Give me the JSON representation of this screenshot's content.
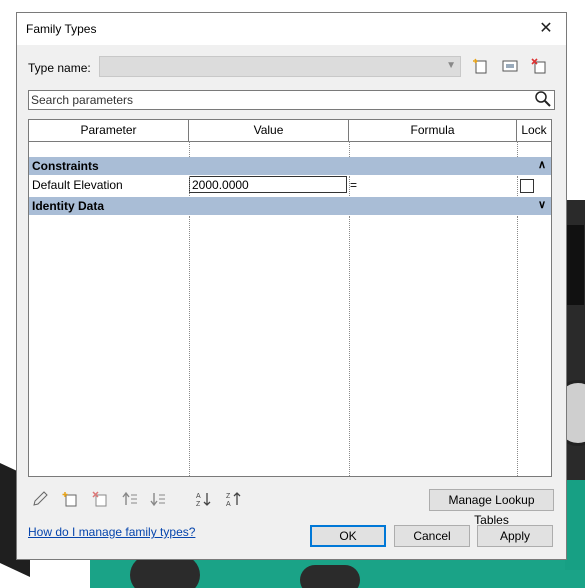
{
  "dialog": {
    "title": "Family Types",
    "close_glyph": "✕"
  },
  "type_name": {
    "label": "Type name:",
    "value": ""
  },
  "search": {
    "placeholder": "Search parameters"
  },
  "grid": {
    "headers": [
      "Parameter",
      "Value",
      "Formula",
      "Lock"
    ],
    "groups": [
      {
        "name": "Constraints",
        "state": "expanded",
        "rows": [
          {
            "parameter": "Default Elevation",
            "value": "2000.0000",
            "formula": "=",
            "locked": false
          }
        ]
      },
      {
        "name": "Identity Data",
        "state": "collapsed",
        "rows": []
      }
    ]
  },
  "icons": {
    "new_type": "new-type-icon",
    "rename_type": "rename-type-icon",
    "delete_type": "delete-type-icon",
    "search": "search-icon",
    "edit_parameter": "pencil-icon",
    "new_parameter": "new-parameter-icon",
    "delete_parameter": "delete-parameter-icon",
    "move_up": "move-up-icon",
    "move_down": "move-down-icon",
    "sort_ascending": "sort-ascending-icon",
    "sort_descending": "sort-descending-icon"
  },
  "buttons": {
    "manage_lookup": "Manage Lookup Tables",
    "ok": "OK",
    "cancel": "Cancel",
    "apply": "Apply"
  },
  "help_link": "How do I manage family types?",
  "colors": {
    "group_header": "#a9bdd6",
    "dialog_bg": "#f0f0f0",
    "ok_border": "#0078d7"
  }
}
